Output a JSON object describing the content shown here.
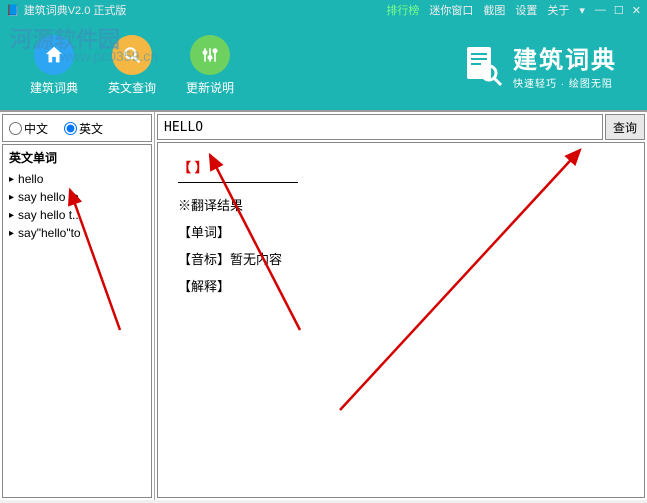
{
  "titlebar": {
    "title": "建筑词典V2.0 正式版",
    "menu": {
      "rank": "排行榜",
      "mini": "迷你窗口",
      "screenshot": "截图",
      "settings": "设置",
      "about": "关于"
    }
  },
  "header": {
    "nav1": "建筑词典",
    "nav2": "英文查询",
    "nav3": "更新说明",
    "brand_title": "建筑词典",
    "brand_sub": "快速轻巧 · 绘图无阻"
  },
  "watermark": {
    "text": "河源软件园",
    "url": "www.pc0359.cn"
  },
  "search": {
    "radio_cn": "中文",
    "radio_en": "英文",
    "input_value": "HELLO",
    "btn": "查询"
  },
  "wordlist": {
    "header": "英文单词",
    "items": [
      "hello",
      "say hello to",
      "say hello t...",
      "say\"hello\"to"
    ]
  },
  "result": {
    "bracket": "【  】",
    "trans_header": "※翻译结果",
    "word_label": "【单词】",
    "phonetic_label": "【音标】暂无内容",
    "explain_label": "【解释】"
  }
}
